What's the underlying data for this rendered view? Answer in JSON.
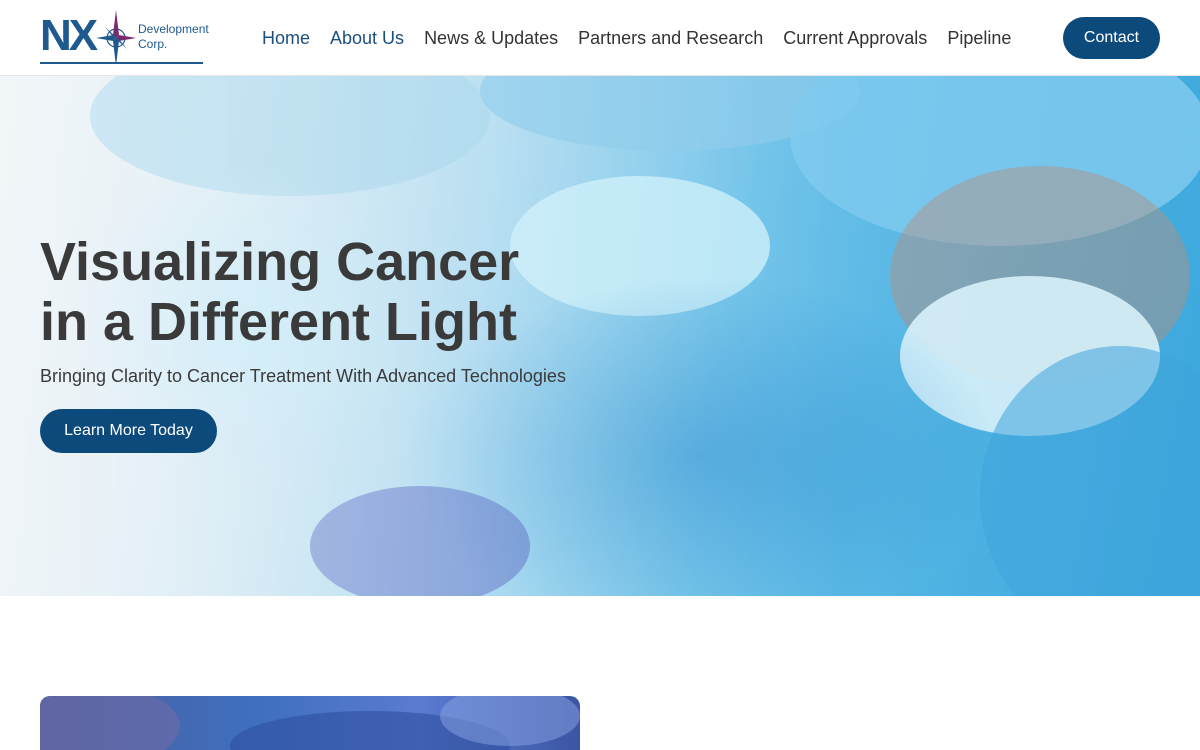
{
  "brand": {
    "letters": "NX",
    "line1": "Development",
    "line2": "Corp.",
    "color": "#1f5a8f"
  },
  "nav": {
    "items": [
      {
        "label": "Home",
        "primary": true
      },
      {
        "label": "About Us",
        "primary": true
      },
      {
        "label": "News & Updates",
        "primary": false
      },
      {
        "label": "Partners and Research",
        "primary": false
      },
      {
        "label": "Current Approvals",
        "primary": false
      },
      {
        "label": "Pipeline",
        "primary": false
      }
    ],
    "contact_label": "Contact"
  },
  "hero": {
    "title_line1": "Visualizing Cancer",
    "title_line2": "in a Different Light",
    "subtitle": "Bringing Clarity to Cancer Treatment With Advanced Technologies",
    "cta_label": "Learn More Today"
  },
  "colors": {
    "accent": "#0d4a7c",
    "heading_text": "#3a3a3a",
    "nav_primary": "#1b4f7f"
  },
  "icons": {
    "logo_mark": "compass-star-icon"
  }
}
